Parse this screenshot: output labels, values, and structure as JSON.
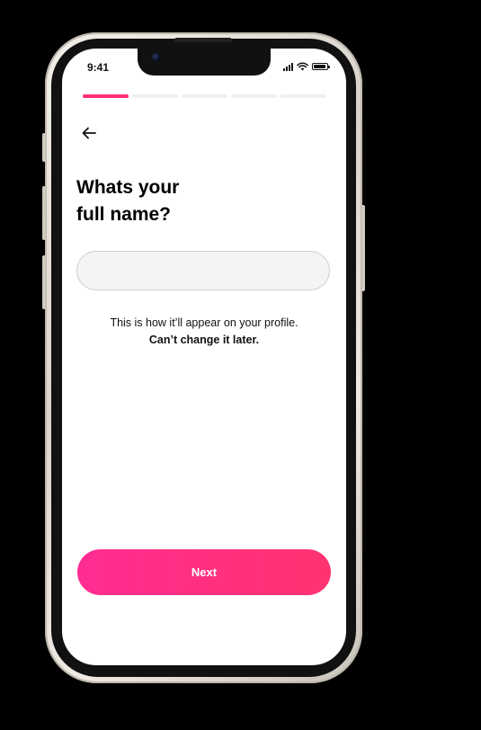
{
  "status_bar": {
    "time": "9:41"
  },
  "progress": {
    "total_steps": 5,
    "current_step": 1
  },
  "question": {
    "line1": "Whats your",
    "line2": "full name?"
  },
  "name_input": {
    "value": "",
    "placeholder": ""
  },
  "hint": {
    "line1": "This is how it’ll appear on your profile.",
    "line2": "Can’t change it later."
  },
  "next_button": {
    "label": "Next"
  },
  "colors": {
    "accent": "#ff2d7a",
    "button_gradient_start": "#ff2d92",
    "button_gradient_end": "#ff3370"
  },
  "icons": {
    "back": "arrow-left-icon",
    "signal": "cellular-signal-icon",
    "wifi": "wifi-icon",
    "battery": "battery-icon"
  }
}
